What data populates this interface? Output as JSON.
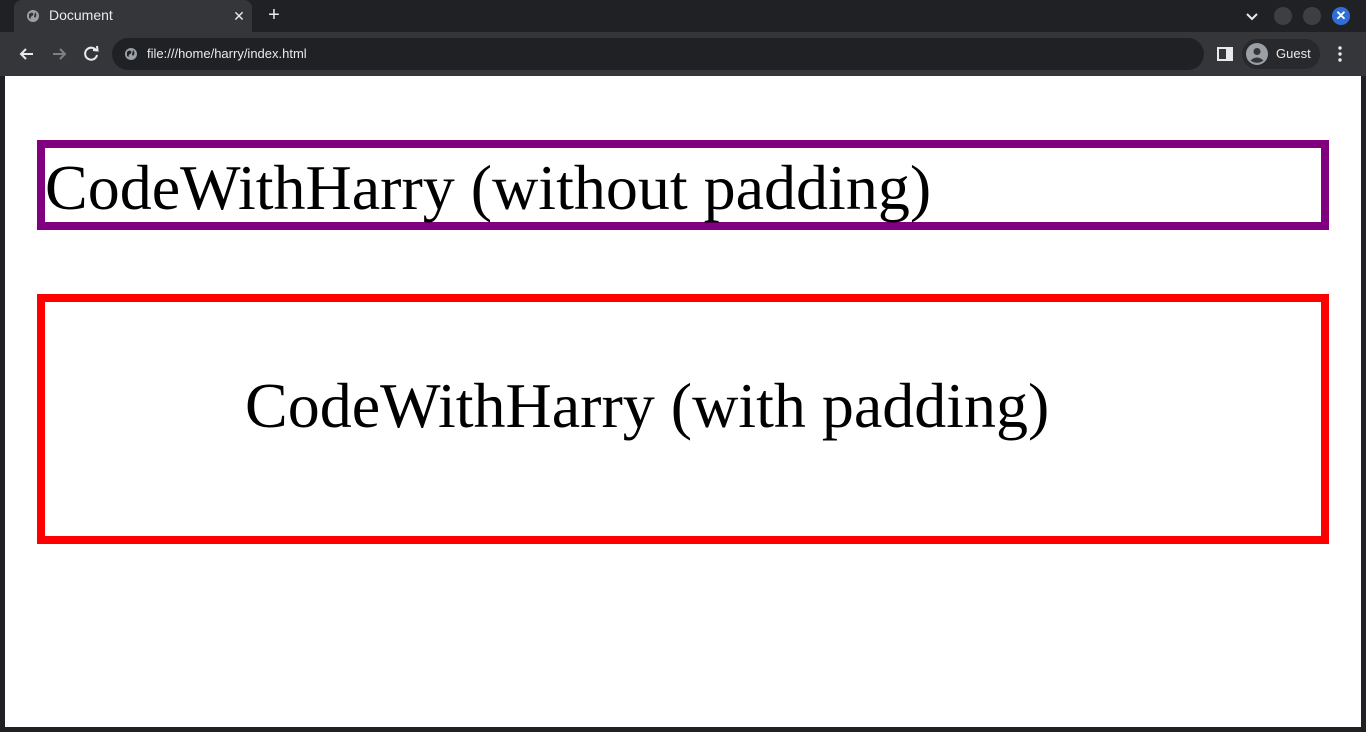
{
  "tab": {
    "title": "Document",
    "favicon_icon": "globe-icon",
    "close_label": "✕"
  },
  "tabstrip": {
    "new_tab_label": "+"
  },
  "window": {
    "close_label": "✕"
  },
  "toolbar": {
    "url": "file:///home/harry/index.html",
    "profile_name": "Guest"
  },
  "page": {
    "box_without_padding": "CodeWithHarry (without padding)",
    "box_with_padding": "CodeWithHarry (with padding)"
  },
  "colors": {
    "without_padding_border": "#800080",
    "with_padding_border": "#ff0000",
    "window_close_button": "#2f6ed8"
  }
}
